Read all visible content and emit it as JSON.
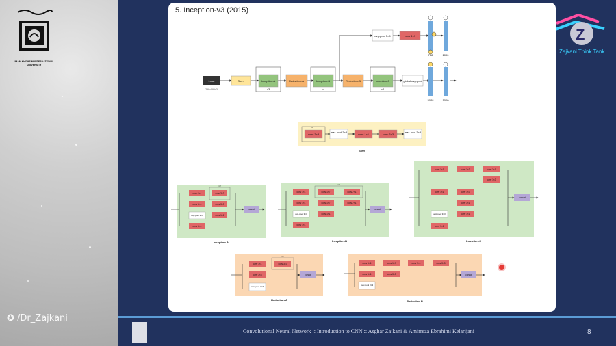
{
  "slide": {
    "title": "5. Inception-v3 (2015)",
    "page_number": "8",
    "footer": "Convolutional Neural Network  ::  Introduction to CNN  ::  Asghar Zajkani & Amirreza Ebrahimi Kelarijani"
  },
  "left_panel": {
    "university": "IMAM KHOMEINI INTERNATIONAL UNIVERSITY",
    "handle": "/Dr_Zajkani"
  },
  "brand": {
    "name": "Zajkani Think Tank"
  },
  "diagram": {
    "top": {
      "input": "input",
      "input_dim": "299×299×3",
      "stem": "Stem",
      "incA": "Inception-A",
      "redA": "Reduction-A",
      "incB": "Inception-B",
      "redB": "Reduction-B",
      "incC": "Inception-C",
      "x3": "×3",
      "x4": "×4",
      "x2": "×2",
      "gap": "global avg-pool",
      "aux_pool": "avg-pool 5×5",
      "aux_conv": "conv 1×1",
      "dim768": "768",
      "dim1000a": "1000",
      "dim2048": "2048",
      "dim1000b": "1000"
    },
    "stem_block": {
      "caption": "Stem",
      "c1": "conv 3×3",
      "x3": "×3",
      "mp1": "max-pool 3×3",
      "c2": "conv 1×1",
      "c3": "conv 3×3",
      "mp2": "max-pool 3×3"
    },
    "labels": {
      "incA": "Inception-A",
      "incB": "Inception-B",
      "incC": "Inception-C",
      "redA": "Reduction-A",
      "redB": "Reduction-B",
      "concat": "concat",
      "c11": "conv 1×1",
      "c33": "conv 3×3",
      "c17": "conv 1×7",
      "c71": "conv 7×1",
      "c13": "conv 1×3",
      "c31": "conv 3×1",
      "avgpool": "avg-pool 3×3",
      "maxpool": "max-pool 3×3",
      "x2": "×2"
    }
  },
  "colors": {
    "conv": "#e06666",
    "concat": "#b4a7d6",
    "stem": "#ffe599",
    "inception": "#93c47d",
    "reduction": "#f6b26b",
    "fc": "#6fa8dc"
  }
}
